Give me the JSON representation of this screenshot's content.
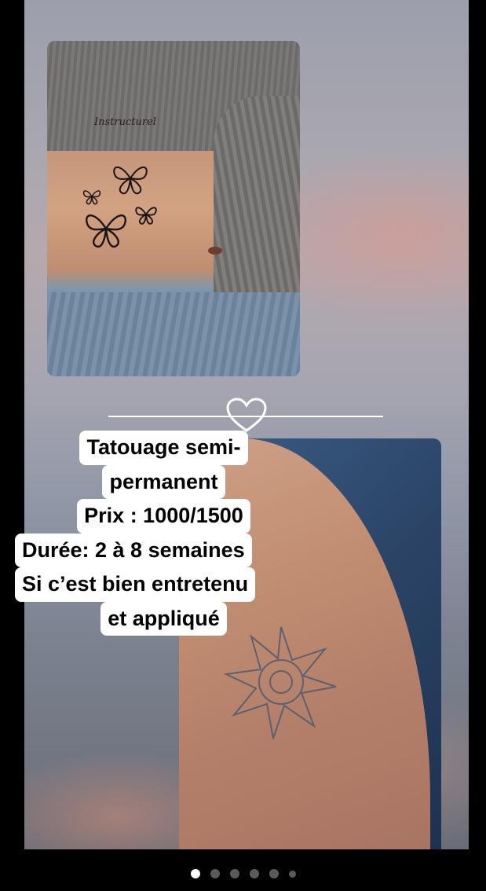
{
  "caption": {
    "line1": "Tatouage semi-",
    "line2": "permanent",
    "line3": "Prix : 1000/1500",
    "line4": "Durée: 2 à 8 semaines",
    "line5": "Si c’est bien entretenu",
    "line6": "et appliqué"
  },
  "top_photo": {
    "script_text": "Instructurel"
  },
  "pagination": {
    "count": 6,
    "active_index": 0
  }
}
